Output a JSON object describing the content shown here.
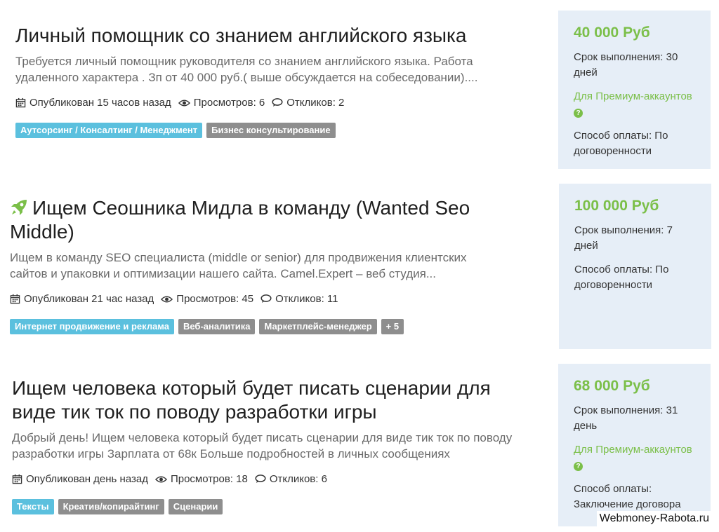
{
  "jobs": [
    {
      "title": "Личный помощник со знанием английского языка",
      "description": "Требуется личный помощник руководителя со знанием английского языка. Работа удаленного характера . Зп от 40 000 руб.( выше обсуждается на собеседовании)....",
      "published": "Опубликован 15 часов назад",
      "views": "Просмотров: 6",
      "responses": "Откликов: 2",
      "tags": [
        {
          "label": "Аутсорсинг / Консалтинг / Менеджмент",
          "color": "blue"
        },
        {
          "label": "Бизнес консультирование",
          "color": "gray"
        }
      ],
      "price": "40 000 Руб",
      "deadline": "Срок выполнения: 30 дней",
      "premium": "Для Премиум-аккаунтов",
      "payment": "Способ оплаты: По договоренности"
    },
    {
      "title": "Ищем Сеошника Мидла в команду (Wanted Seo Middle)",
      "icon": "rocket-icon",
      "description": "Ищем в команду SEO специалиста (middle or senior) для продвижения клиентских сайтов и упаковки и оптимизации нашего сайта. Camel.Expert – веб студия...",
      "published": "Опубликован 21 час назад",
      "views": "Просмотров: 45",
      "responses": "Откликов: 11",
      "tags": [
        {
          "label": "Интернет продвижение и реклама",
          "color": "blue"
        },
        {
          "label": "Веб-аналитика",
          "color": "gray"
        },
        {
          "label": "Маркетплейс-менеджер",
          "color": "gray"
        },
        {
          "label": "+ 5",
          "color": "gray"
        }
      ],
      "price": "100 000 Руб",
      "deadline": "Срок выполнения: 7 дней",
      "payment": "Способ оплаты: По договоренности"
    },
    {
      "title": "Ищем человека который будет писать сценарии для виде тик ток по поводу разработки игры",
      "description": "Добрый день! Ищем человека который будет писать сценарии для виде тик ток по поводу разработки игры Зарплата от 68к Больше подробностей в личных сообщениях",
      "published": "Опубликован день назад",
      "views": "Просмотров: 18",
      "responses": "Откликов: 6",
      "tags": [
        {
          "label": "Тексты",
          "color": "blue"
        },
        {
          "label": "Креатив/копирайтинг",
          "color": "gray"
        },
        {
          "label": "Сценарии",
          "color": "gray"
        }
      ],
      "price": "68 000 Руб",
      "deadline": "Срок выполнения: 31 день",
      "premium": "Для Премиум-аккаунтов",
      "payment": "Способ оплаты: Заключение договора"
    }
  ],
  "watermark": "Webmoney-Rabota.ru",
  "colors": {
    "price": "#7bbf49",
    "tag_blue": "#5bc0de",
    "tag_gray": "#8e8e8e",
    "sidebar_bg": "#e6eef7"
  }
}
